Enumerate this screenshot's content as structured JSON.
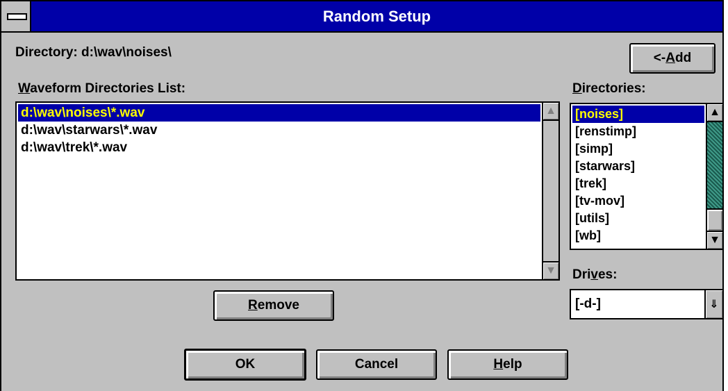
{
  "window": {
    "title": "Random Setup"
  },
  "directory": {
    "label": "Directory:",
    "value": "d:\\wav\\noises\\"
  },
  "buttons": {
    "add": {
      "prefix": "<-",
      "accel": "A",
      "rest": "dd"
    },
    "remove": {
      "accel": "R",
      "rest": "emove"
    },
    "ok": {
      "label": "OK"
    },
    "cancel": {
      "label": "Cancel"
    },
    "help": {
      "accel": "H",
      "rest": "elp"
    }
  },
  "waveform_list": {
    "label_accel": "W",
    "label_rest": "aveform Directories List:",
    "items": [
      {
        "text": "d:\\wav\\noises\\*.wav",
        "selected": true
      },
      {
        "text": "d:\\wav\\starwars\\*.wav",
        "selected": false
      },
      {
        "text": "d:\\wav\\trek\\*.wav",
        "selected": false
      }
    ]
  },
  "directories": {
    "label_accel": "D",
    "label_rest": "irectories:",
    "items": [
      {
        "text": "[noises]",
        "selected": true
      },
      {
        "text": "[renstimp]",
        "selected": false
      },
      {
        "text": "[simp]",
        "selected": false
      },
      {
        "text": "[starwars]",
        "selected": false
      },
      {
        "text": "[trek]",
        "selected": false
      },
      {
        "text": "[tv-mov]",
        "selected": false
      },
      {
        "text": "[utils]",
        "selected": false
      },
      {
        "text": "[wb]",
        "selected": false
      }
    ]
  },
  "drives": {
    "label_pre": "Dri",
    "label_accel": "v",
    "label_post": "es:",
    "selected": "[-d-]"
  },
  "icons": {
    "system_menu": "system-menu-icon",
    "arrow_up": "▲",
    "arrow_down": "▼",
    "combo_arrow": "⇓"
  },
  "colors": {
    "title_bar": "#0000a8",
    "selection_bg": "#0000a8",
    "selection_fg": "#ffff00",
    "face": "#c0c0c0",
    "scroll_track": "#2e7d6e"
  }
}
